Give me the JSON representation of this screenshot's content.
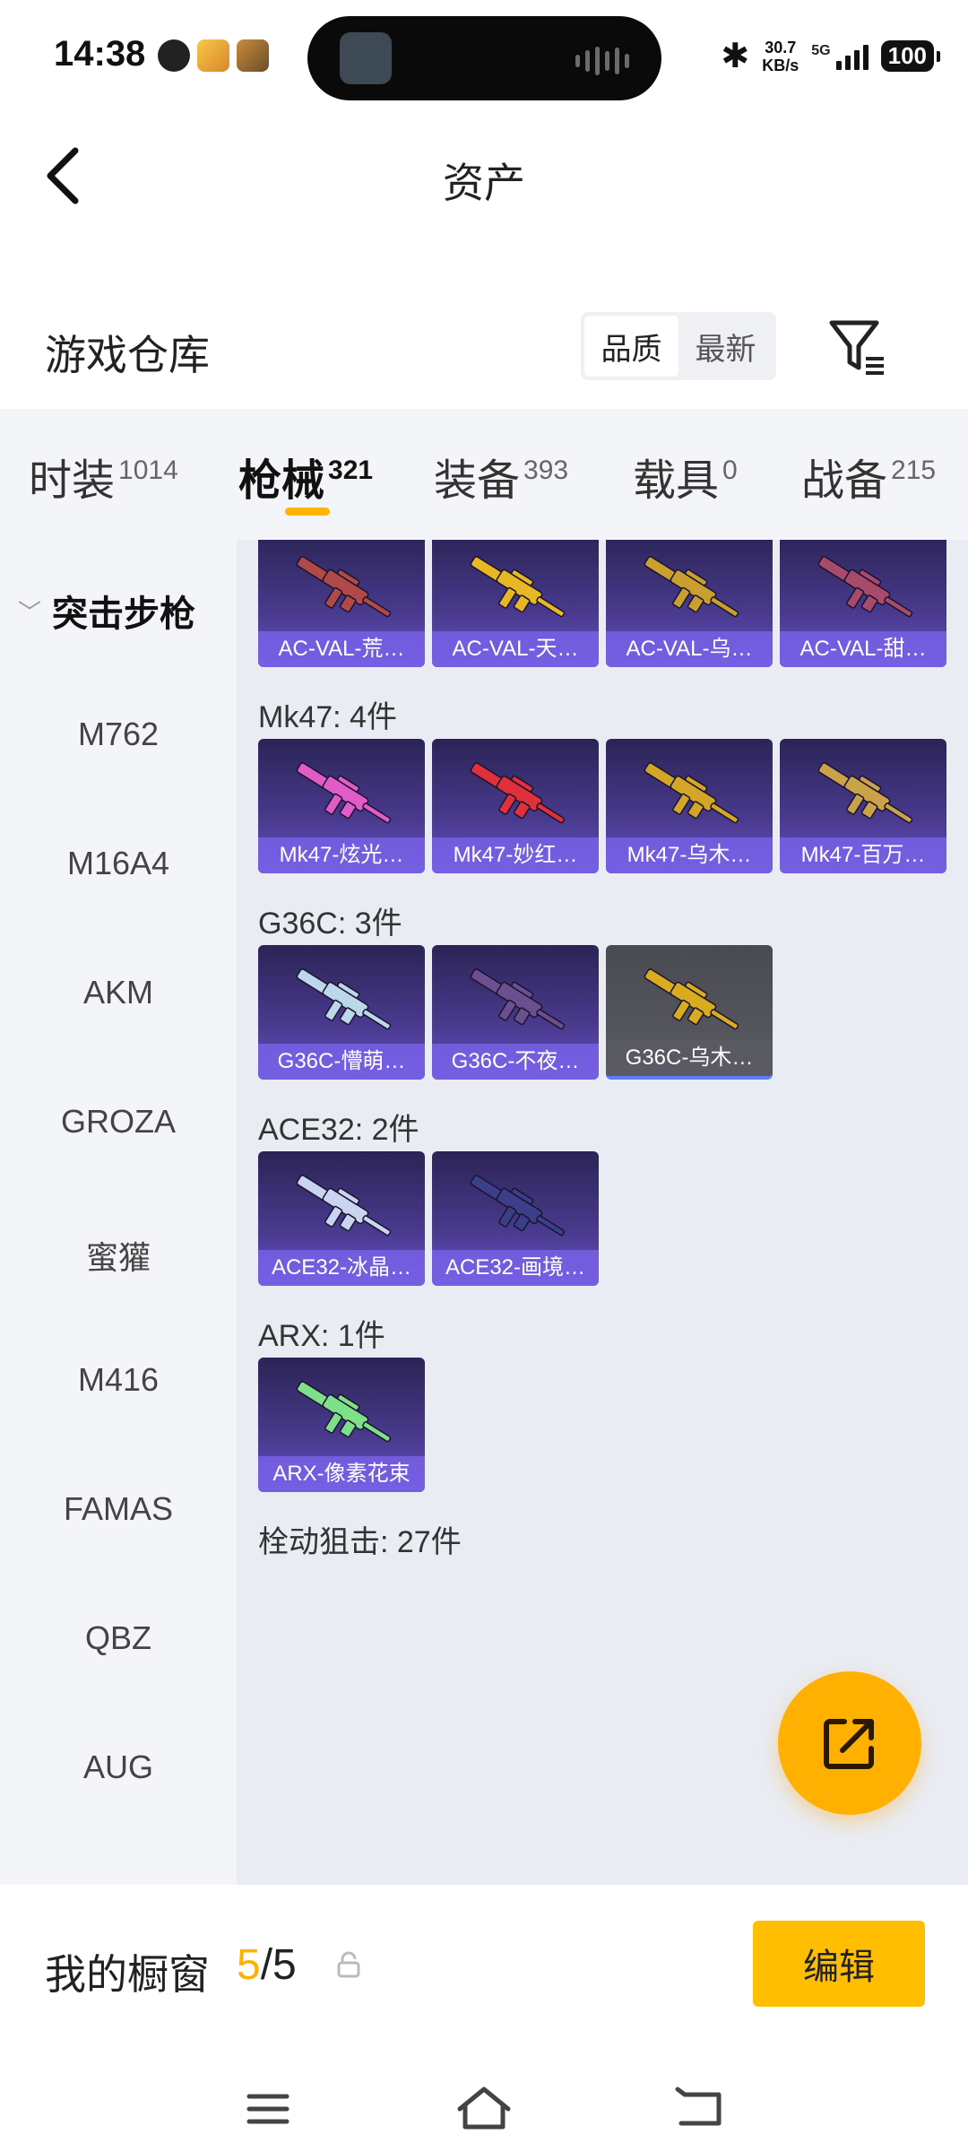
{
  "status_bar": {
    "time": "14:38",
    "net_speed_value": "30.7",
    "net_speed_unit": "KB/s",
    "network": "5G",
    "battery": "100"
  },
  "header": {
    "title": "资产"
  },
  "warehouse": {
    "title": "游戏仓库",
    "sort_options": [
      "品质",
      "最新"
    ],
    "active_sort": "品质"
  },
  "tabs": [
    {
      "label": "时装",
      "count": "1014"
    },
    {
      "label": "枪械",
      "count": "321",
      "active": true
    },
    {
      "label": "装备",
      "count": "393"
    },
    {
      "label": "载具",
      "count": "0"
    },
    {
      "label": "战备",
      "count": "215"
    }
  ],
  "sidebar": {
    "group": "突击步枪",
    "items": [
      "M762",
      "M16A4",
      "AKM",
      "GROZA",
      "蜜獾",
      "M416",
      "FAMAS",
      "QBZ",
      "AUG"
    ]
  },
  "sections": [
    {
      "label": "",
      "items": [
        {
          "name": "AC-VAL-荒…",
          "color": "#b04a48"
        },
        {
          "name": "AC-VAL-天…",
          "color": "#e7b823"
        },
        {
          "name": "AC-VAL-乌…",
          "color": "#c9a030"
        },
        {
          "name": "AC-VAL-甜…",
          "color": "#a84a6a"
        }
      ]
    },
    {
      "label": "Mk47: 4件",
      "items": [
        {
          "name": "Mk47-炫光…",
          "color": "#e25cc8"
        },
        {
          "name": "Mk47-妙红…",
          "color": "#e0303a"
        },
        {
          "name": "Mk47-乌木…",
          "color": "#d4a628"
        },
        {
          "name": "Mk47-百万…",
          "color": "#caa24a"
        }
      ]
    },
    {
      "label": "G36C: 3件",
      "items": [
        {
          "name": "G36C-懵萌…",
          "color": "#bcd6ea"
        },
        {
          "name": "G36C-不夜…",
          "color": "#6b4f8e"
        },
        {
          "name": "G36C-乌木…",
          "color": "#d9ab1e",
          "dim": true
        }
      ]
    },
    {
      "label": "ACE32: 2件",
      "items": [
        {
          "name": "ACE32-冰晶…",
          "color": "#c8d4f0"
        },
        {
          "name": "ACE32-画境…",
          "color": "#3b3f8a"
        }
      ]
    },
    {
      "label": "ARX: 1件",
      "items": [
        {
          "name": "ARX-像素花束",
          "color": "#7fe08a"
        }
      ]
    },
    {
      "label": "栓动狙击: 27件",
      "items": []
    }
  ],
  "bottom": {
    "showcase_label": "我的橱窗",
    "showcase_current": "5",
    "showcase_total": "/5",
    "edit_label": "编辑"
  },
  "icons": {
    "back": "back-arrow-icon",
    "filter": "filter-icon",
    "fab": "share-external-icon",
    "lock": "lock-icon"
  },
  "colors": {
    "accent": "#ffb400",
    "card_top": "#2b2456",
    "card_bottom": "#6452c7"
  }
}
